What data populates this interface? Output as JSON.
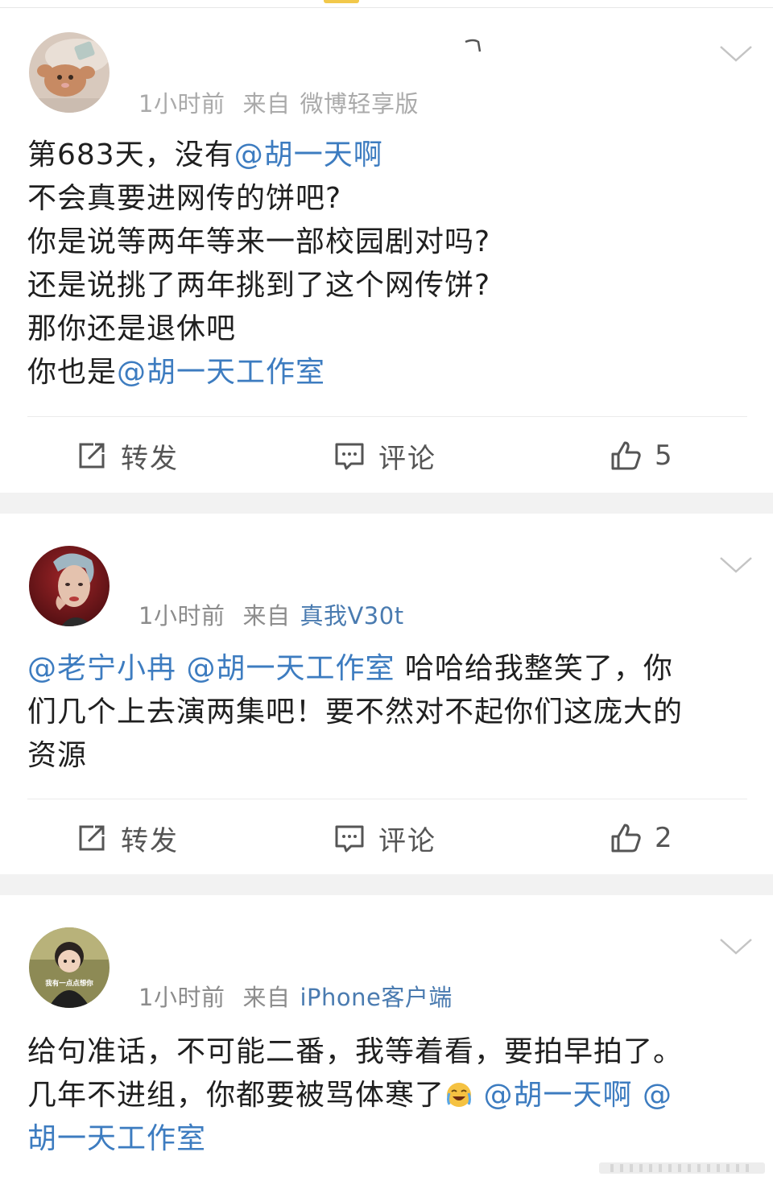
{
  "posts": [
    {
      "meta_time": "1小时前",
      "meta_from": "来自",
      "meta_source": "微博轻享版",
      "content_lines": [
        [
          {
            "t": "第683天，没有"
          },
          {
            "t": "@胡一天啊",
            "m": true
          }
        ],
        [
          {
            "t": "不会真要进网传的饼吧?"
          }
        ],
        [
          {
            "t": "你是说等两年等来一部校园剧对吗?"
          }
        ],
        [
          {
            "t": "还是说挑了两年挑到了这个网传饼?"
          }
        ],
        [
          {
            "t": "那你还是退休吧"
          }
        ],
        [
          {
            "t": "你也是"
          },
          {
            "t": "@胡一天工作室",
            "m": true
          }
        ]
      ],
      "repost_label": "转发",
      "comment_label": "评论",
      "like_count": "5"
    },
    {
      "meta_time": "1小时前",
      "meta_from": "来自",
      "meta_source": "真我V30t",
      "content_lines": [
        [
          {
            "t": "@老宁小冉",
            "m": true
          },
          {
            "t": " "
          },
          {
            "t": "@胡一天工作室",
            "m": true
          },
          {
            "t": " 哈哈给我整笑了，你"
          }
        ],
        [
          {
            "t": "们几个上去演两集吧！要不然对不起你们这庞大的"
          }
        ],
        [
          {
            "t": "资源"
          }
        ]
      ],
      "repost_label": "转发",
      "comment_label": "评论",
      "like_count": "2"
    },
    {
      "meta_time": "1小时前",
      "meta_from": "来自",
      "meta_source": "iPhone客户端",
      "content_lines": [
        [
          {
            "t": "给句准话，不可能二番，我等着看，要拍早拍了。"
          }
        ],
        [
          {
            "t": "几年不进组，你都要被骂体寒了"
          },
          {
            "e": "cry-laugh-emoji"
          },
          {
            "t": " "
          },
          {
            "t": "@胡一天啊",
            "m": true
          },
          {
            "t": " "
          },
          {
            "t": "@",
            "m": true
          }
        ],
        [
          {
            "t": "胡一天工作室",
            "m": true
          }
        ]
      ]
    }
  ],
  "avatar3_caption": "我有一点点想你",
  "colors": {
    "mention": "#3d7cc0",
    "source": "#4a7bb0",
    "meta": "#8c8c8c",
    "separator": "#f2f2f2"
  },
  "icons": {
    "repost": "share-square-icon",
    "comment": "comment-bubble-icon",
    "like": "thumbs-up-icon",
    "more": "chevron-down-icon"
  }
}
